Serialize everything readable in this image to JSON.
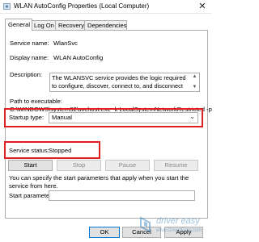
{
  "window": {
    "title": "WLAN AutoConfig Properties (Local Computer)",
    "close_glyph": "✕",
    "icon": "gear-icon"
  },
  "tabs": [
    {
      "label": "General",
      "active": true
    },
    {
      "label": "Log On",
      "active": false
    },
    {
      "label": "Recovery",
      "active": false
    },
    {
      "label": "Dependencies",
      "active": false
    }
  ],
  "general": {
    "service_name_label": "Service name:",
    "service_name_value": "WlanSvc",
    "display_name_label": "Display name:",
    "display_name_value": "WLAN AutoConfig",
    "description_label": "Description:",
    "description_value": "The WLANSVC service provides the logic required to configure, discover, connect to, and disconnect",
    "path_label": "Path to executable:",
    "path_value": "C:\\WINDOWS\\system32\\svchost.exe -k LocalSystemNetworkRestricted -p",
    "startup_type_label": "Startup type:",
    "startup_type_value": "Manual",
    "service_status_label": "Service status:",
    "service_status_value": "Stopped",
    "hint_text": "You can specify the start parameters that apply when you start the service from here.",
    "start_params_label": "Start parameters:",
    "start_params_value": ""
  },
  "service_buttons": {
    "start": "Start",
    "stop": "Stop",
    "pause": "Pause",
    "resume": "Resume"
  },
  "footer_buttons": {
    "ok": "OK",
    "cancel": "Cancel",
    "apply": "Apply"
  },
  "watermark": {
    "name": "driver easy",
    "url": "www.DriverEasy.com"
  },
  "colors": {
    "highlight_border": "#e02020",
    "accent": "#0078d7"
  }
}
